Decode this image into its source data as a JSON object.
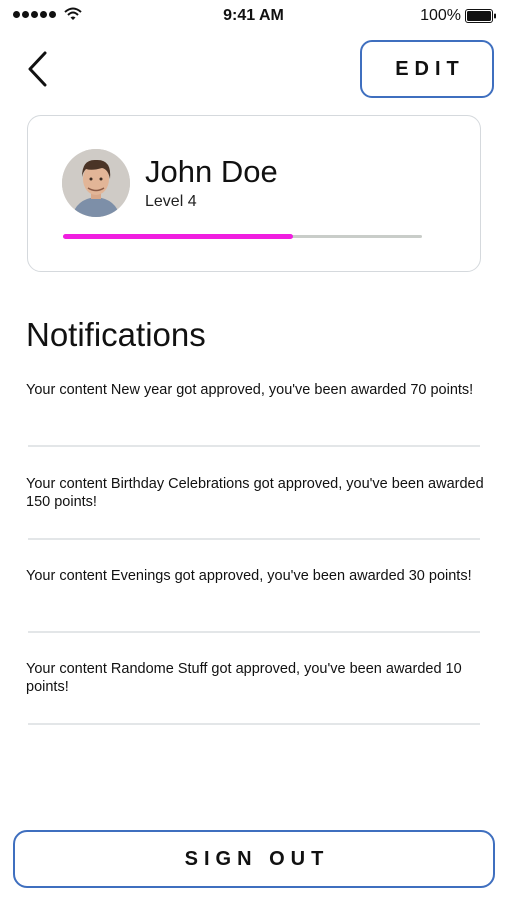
{
  "status_bar": {
    "time": "9:41 AM",
    "battery": "100%"
  },
  "nav": {
    "edit_label": "EDIT"
  },
  "profile": {
    "name": "John Doe",
    "level": "Level 4",
    "progress": 0.64
  },
  "notifications": {
    "title": "Notifications",
    "items": [
      "Your content New year got approved, you've been awarded 70 points!",
      "Your content Birthday Celebrations got approved, you've been awarded 150 points!",
      "Your content Evenings got approved, you've been awarded 30 points!",
      "Your content Randome Stuff got approved, you've been awarded 10 points!"
    ]
  },
  "footer": {
    "signout_label": "SIGN OUT"
  },
  "colors": {
    "accent": "#3f6fbf",
    "progress": "#f01ee0",
    "track": "#c9cdc9",
    "border": "#d5d9dd"
  }
}
